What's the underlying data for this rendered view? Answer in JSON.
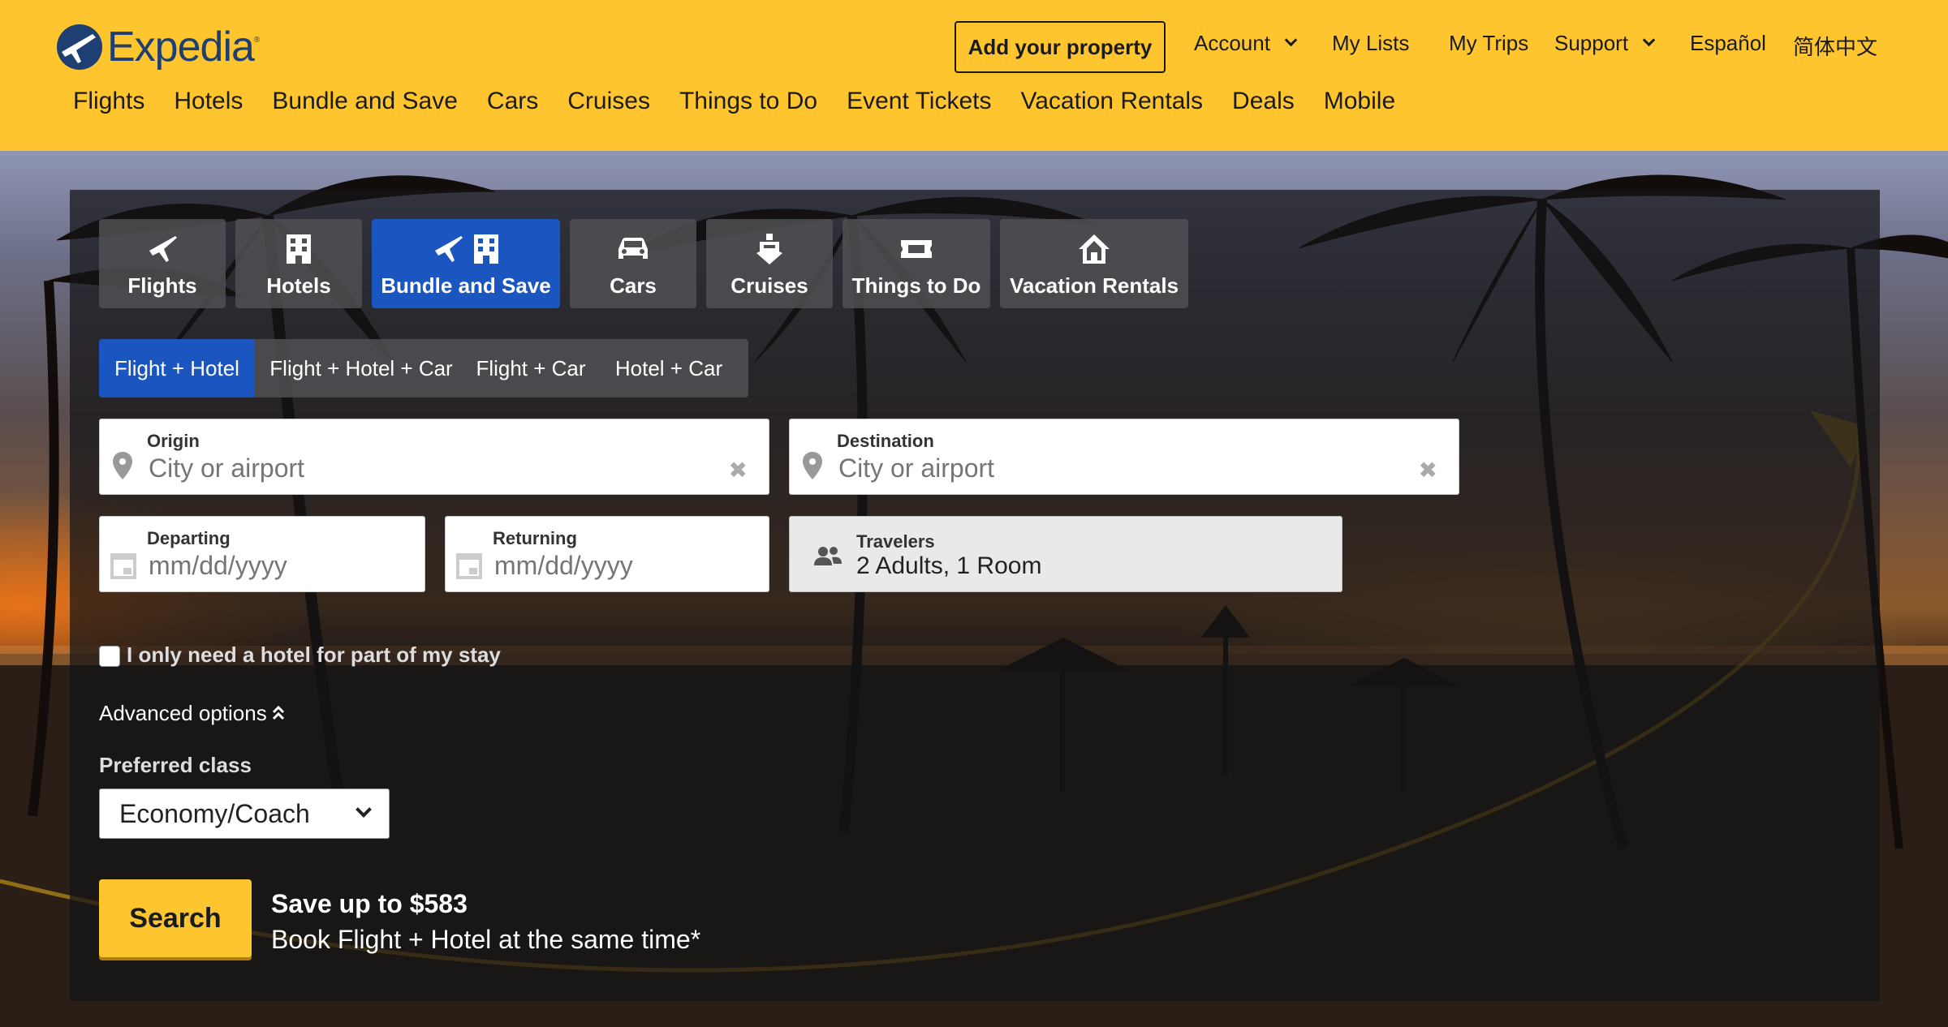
{
  "brand": {
    "name": "Expedia",
    "mark": "®",
    "color": "#1d3f71",
    "header_bg": "#fec52e"
  },
  "utility_nav": {
    "add_property": "Add your property",
    "account": "Account",
    "my_lists": "My Lists",
    "my_trips": "My Trips",
    "support": "Support",
    "espanol": "Español",
    "chinese": "简体中文"
  },
  "main_nav": [
    "Flights",
    "Hotels",
    "Bundle and Save",
    "Cars",
    "Cruises",
    "Things to Do",
    "Event Tickets",
    "Vacation Rentals",
    "Deals",
    "Mobile"
  ],
  "product_tabs": [
    {
      "label": "Flights",
      "icon": "plane-icon",
      "active": false
    },
    {
      "label": "Hotels",
      "icon": "building-icon",
      "active": false
    },
    {
      "label": "Bundle and Save",
      "icon": "plane-building-icon",
      "active": true
    },
    {
      "label": "Cars",
      "icon": "car-icon",
      "active": false
    },
    {
      "label": "Cruises",
      "icon": "ship-icon",
      "active": false
    },
    {
      "label": "Things to Do",
      "icon": "ticket-icon",
      "active": false
    },
    {
      "label": "Vacation Rentals",
      "icon": "house-icon",
      "active": false
    }
  ],
  "sub_tabs": [
    {
      "label": "Flight + Hotel",
      "active": true
    },
    {
      "label": "Flight + Hotel + Car",
      "active": false
    },
    {
      "label": "Flight + Car",
      "active": false
    },
    {
      "label": "Hotel + Car",
      "active": false
    }
  ],
  "form": {
    "origin": {
      "label": "Origin",
      "placeholder": "City or airport"
    },
    "destination": {
      "label": "Destination",
      "placeholder": "City or airport"
    },
    "departing": {
      "label": "Departing",
      "placeholder": "mm/dd/yyyy"
    },
    "returning": {
      "label": "Returning",
      "placeholder": "mm/dd/yyyy"
    },
    "travelers": {
      "label": "Travelers",
      "value": "2 Adults, 1 Room"
    },
    "partial_stay": "I only need a hotel for part of my stay",
    "advanced": "Advanced options",
    "preferred_class_label": "Preferred class",
    "preferred_class_value": "Economy/Coach",
    "search": "Search",
    "promo_title": "Save up to $583",
    "promo_sub": "Book Flight + Hotel at the same time*"
  },
  "colors": {
    "active_tab": "#1a55c0",
    "search_btn": "#fec52e"
  }
}
